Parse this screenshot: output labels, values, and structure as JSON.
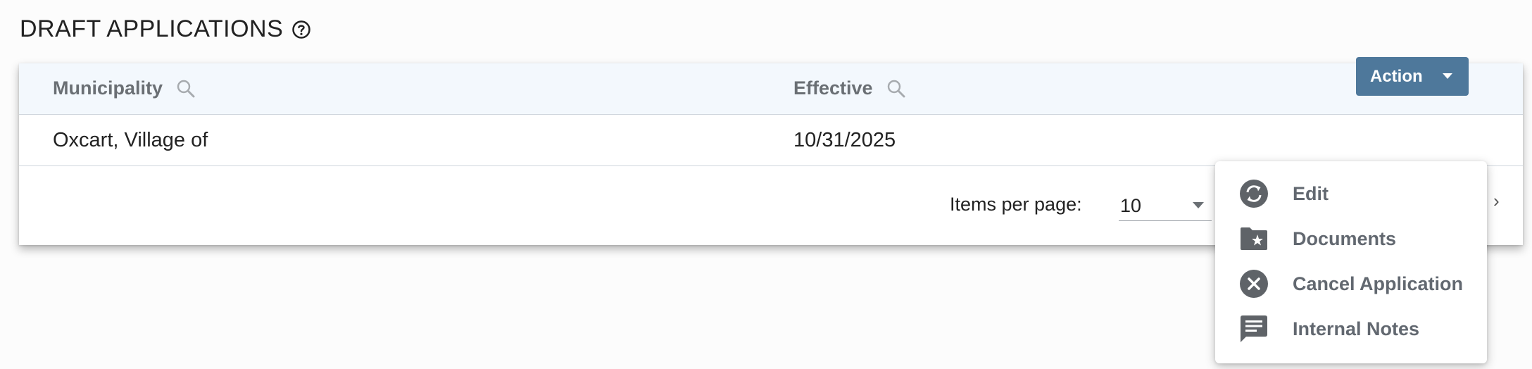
{
  "page": {
    "title": "DRAFT APPLICATIONS",
    "help_icon": "help-circle-icon"
  },
  "table": {
    "columns": [
      {
        "label": "Municipality",
        "icon": "search-icon"
      },
      {
        "label": "Effective",
        "icon": "search-icon"
      }
    ],
    "rows": [
      {
        "municipality": "Oxcart, Village of",
        "effective": "10/31/2025",
        "action_label": "Action"
      }
    ]
  },
  "paginator": {
    "items_per_page_label": "Items per page:",
    "items_per_page_value": "10"
  },
  "action_menu": {
    "items": [
      {
        "label": "Edit",
        "icon": "sync-icon"
      },
      {
        "label": "Documents",
        "icon": "folder-star-icon"
      },
      {
        "label": "Cancel Application",
        "icon": "cancel-circle-icon"
      },
      {
        "label": "Internal Notes",
        "icon": "comment-notes-icon"
      }
    ]
  },
  "colors": {
    "action_button": "#4e789b",
    "header_background": "#f3f8fd",
    "menu_icon": "#5f6368"
  }
}
